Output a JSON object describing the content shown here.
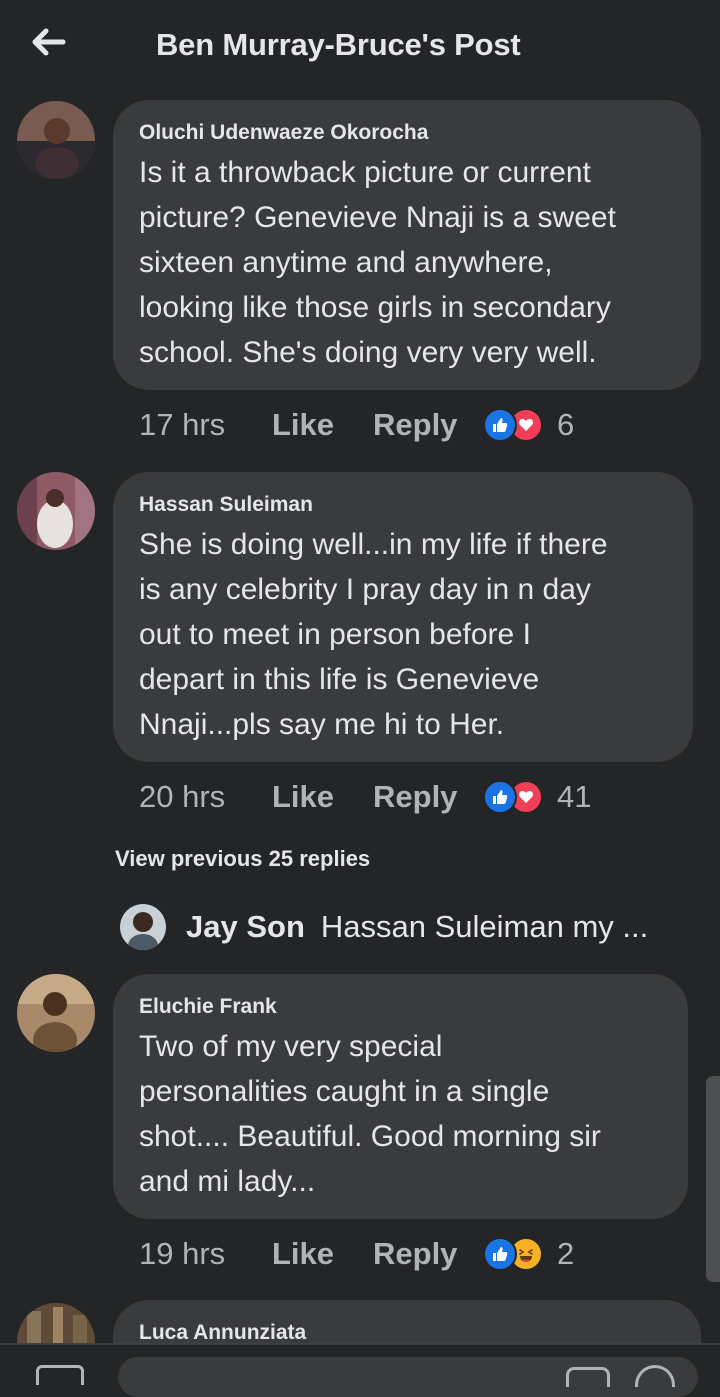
{
  "header": {
    "title": "Ben Murray-Bruce's Post"
  },
  "comments": [
    {
      "name": "Oluchi Udenwaeze Okorocha",
      "lines": [
        "Is it a throwback picture or  current",
        "picture? Genevieve  Nnaji is a sweet",
        "sixteen anytime and anywhere,",
        "looking like those girls in secondary",
        "school. She's doing very very well."
      ],
      "time": "17 hrs",
      "like": "Like",
      "reply": "Reply",
      "reactions": [
        "like-icon",
        "love-icon"
      ],
      "count": "6"
    },
    {
      "name": "Hassan Suleiman",
      "lines": [
        "She is doing well...in my life if there",
        "is any celebrity I pray day in n day",
        "out to meet in person before I",
        "depart in this life is Genevieve",
        "Nnaji...pls say me hi to Her."
      ],
      "time": "20 hrs",
      "like": "Like",
      "reply": "Reply",
      "reactions": [
        "like-icon",
        "love-icon"
      ],
      "count": "41"
    },
    {
      "name": "Eluchie Frank",
      "lines": [
        "Two of my very special",
        "personalities caught in a single",
        "shot.... Beautiful. Good morning sir",
        "and mi lady..."
      ],
      "time": "19 hrs",
      "like": "Like",
      "reply": "Reply",
      "reactions": [
        "like-icon",
        "haha-icon"
      ],
      "count": "2"
    },
    {
      "name": "Luca Annunziata"
    }
  ],
  "replies": {
    "view_previous": "View previous 25 replies",
    "latest": {
      "name": "Jay Son",
      "text": "Hassan Suleiman my ..."
    }
  }
}
